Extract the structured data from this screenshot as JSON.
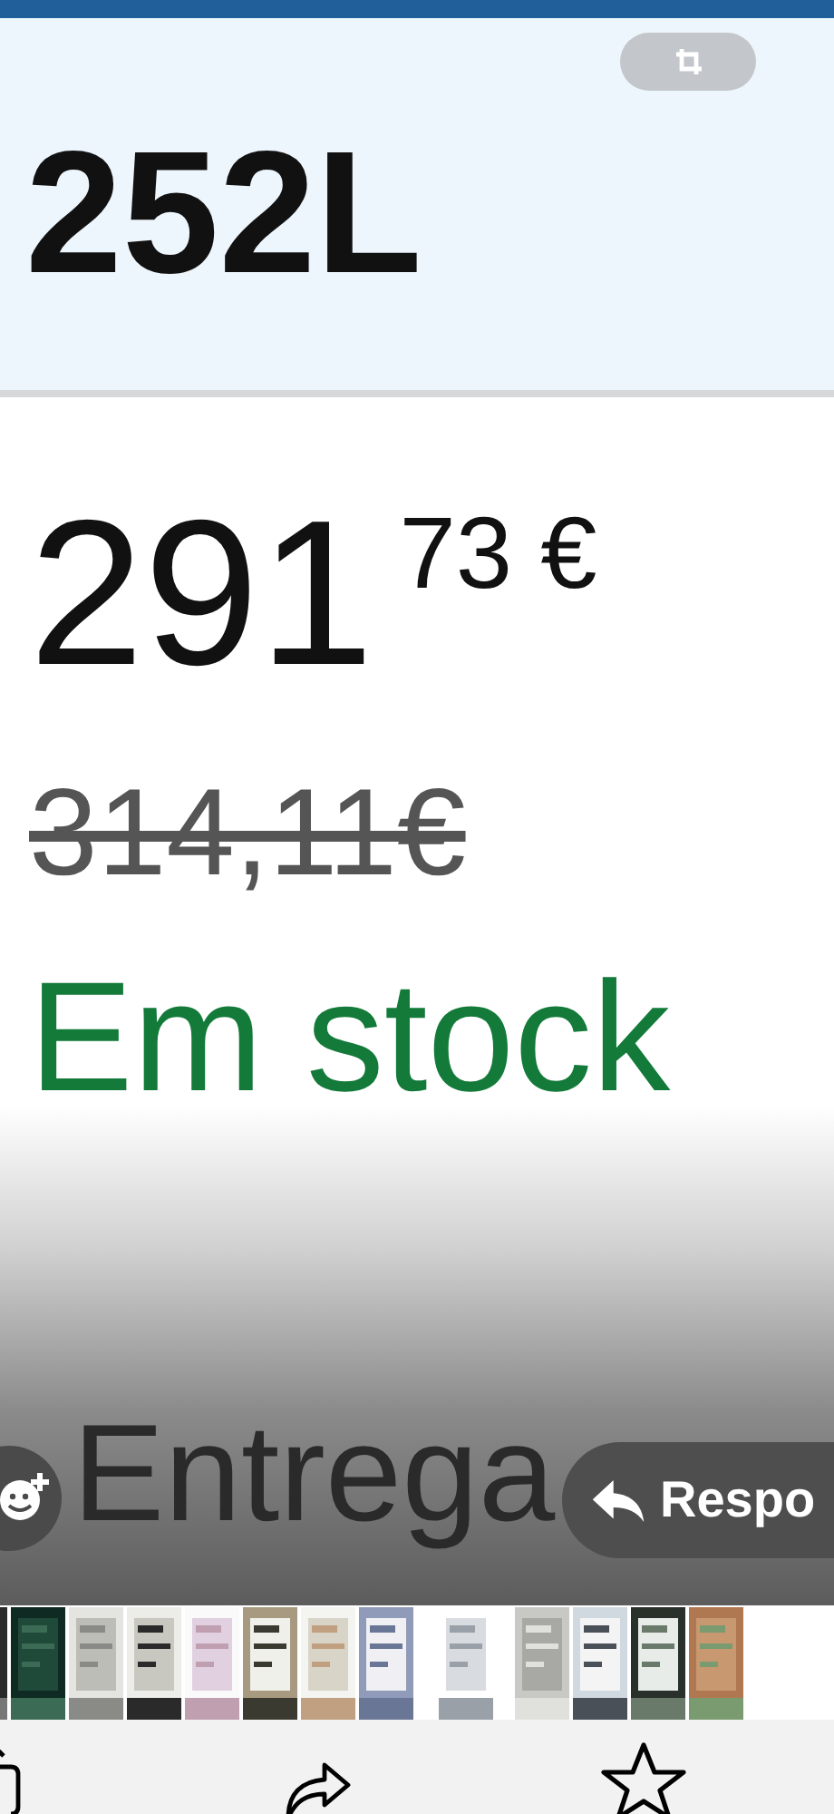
{
  "product": {
    "capacity": "252L",
    "price_whole": "291",
    "price_fraction": "73 €",
    "old_price": "314,11€",
    "availability": "Em stock",
    "delivery_label": "Entrega"
  },
  "reply_button": {
    "label": "Respo"
  }
}
